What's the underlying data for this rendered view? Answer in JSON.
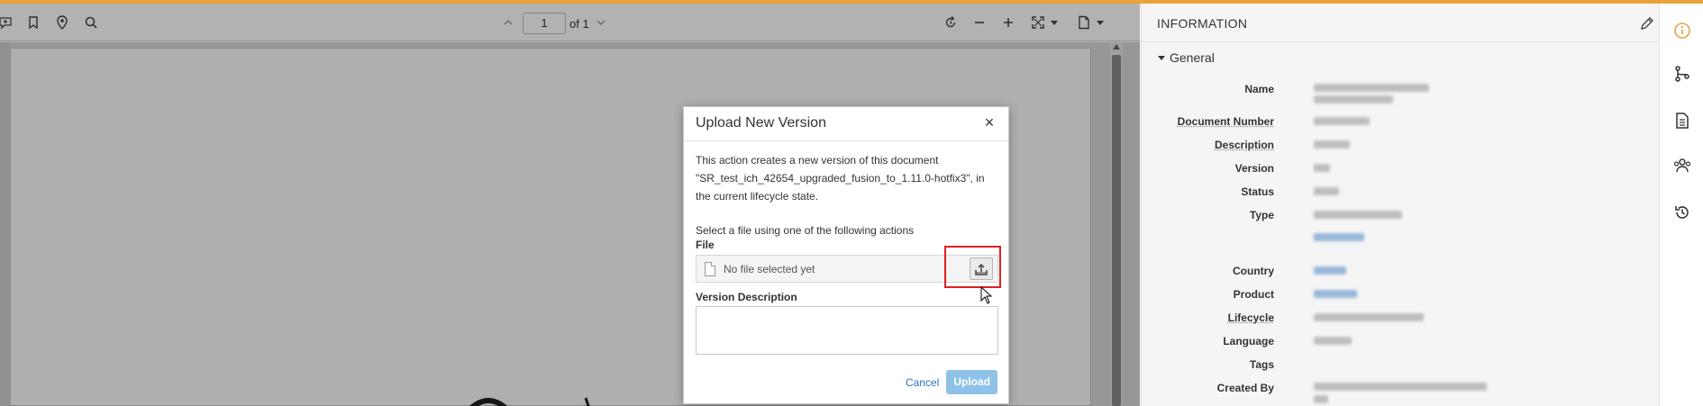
{
  "viewer": {
    "page_current": "1",
    "page_total_label": "of 1"
  },
  "modal": {
    "title": "Upload New Version",
    "close_glyph": "×",
    "description": "This action creates a new version of this document \"SR_test_ich_42654_upgraded_fusion_to_1.11.0-hotfix3\", in the current lifecycle state.",
    "select_hint": "Select a file using one of the following actions",
    "file_label": "File",
    "file_placeholder": "No file selected yet",
    "version_description_label": "Version Description",
    "cancel_label": "Cancel",
    "upload_label": "Upload"
  },
  "info": {
    "title": "INFORMATION",
    "section": "General",
    "properties": [
      {
        "label": "Name"
      },
      {
        "label": "Document Number"
      },
      {
        "label": "Description"
      },
      {
        "label": "Version"
      },
      {
        "label": "Status"
      },
      {
        "label": "Type"
      },
      {
        "label": "Country"
      },
      {
        "label": "Product"
      },
      {
        "label": "Lifecycle"
      },
      {
        "label": "Language"
      },
      {
        "label": "Tags"
      },
      {
        "label": "Created By"
      }
    ]
  },
  "colors": {
    "accent_line": "#e8a33d",
    "link": "#2a78c0",
    "upload_button": "#8ec2e8",
    "highlight": "#e02020",
    "rail_active": "#e8a33d"
  },
  "icons": {
    "toolbar_left": [
      "comment-add-icon",
      "bookmark-icon",
      "location-pin-icon",
      "search-icon"
    ],
    "toolbar_right": [
      "rotate-icon",
      "zoom-out-icon",
      "zoom-in-icon",
      "fit-page-icon",
      "document-menu-icon"
    ],
    "rail": [
      "info-icon",
      "branch-icon",
      "document-icon",
      "people-icon",
      "history-icon"
    ]
  }
}
